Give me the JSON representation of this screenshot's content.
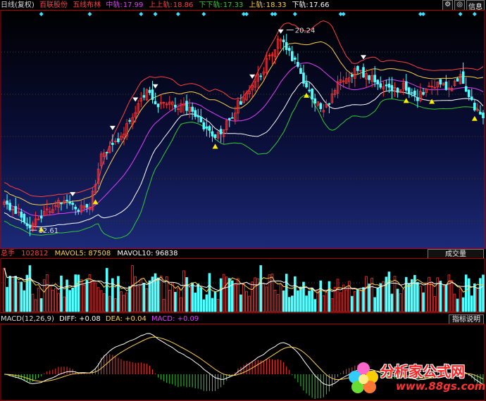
{
  "window": {
    "period_label": "日线(复权)",
    "stock_name": "百联股份",
    "indicator_name": "五线布林",
    "buttons": [
      {
        "label": "⚙"
      },
      {
        "label": "◎"
      },
      {
        "label": "信息"
      }
    ],
    "readouts": [
      {
        "label": "中轨:",
        "value": "17.99",
        "color": "#e040fb"
      },
      {
        "label": "上上轨:",
        "value": "18.86",
        "color": "#ff4040"
      },
      {
        "label": "下下轨:",
        "value": "17.33",
        "color": "#32cd32"
      },
      {
        "label": "上轨:",
        "value": "18.33",
        "color": "#ffd24a"
      },
      {
        "label": "下轨:",
        "value": "17.66",
        "color": "#ffffff"
      }
    ]
  },
  "price_panel": {
    "high_label": "20.24",
    "low_label": "12.61"
  },
  "volume_panel": {
    "title": "总手",
    "value": "102812",
    "mavol5_label": "MAVOL5:",
    "mavol5": "87508",
    "mavol10_label": "MAVOL10:",
    "mavol10": "96838",
    "button_label": "成交量"
  },
  "macd_panel": {
    "title": "MACD(12,26,9)",
    "diff_label": "DIFF:",
    "diff": "+0.08",
    "dea_label": "DEA:",
    "dea": "+0.04",
    "macd_label": "MACD:",
    "macd": "+0.09",
    "button_label": "指标说明"
  },
  "watermark": {
    "title": "分析家公式网",
    "url": "www.88gs.com"
  },
  "colors": {
    "up": "#ff3232",
    "down": "#54ffff",
    "upper2": "#ff4040",
    "upper": "#ffd24a",
    "mid": "#e040fb",
    "lower": "#ffffff",
    "lower2": "#32cd32"
  },
  "chart_data": {
    "type": "line",
    "price_range": [
      12.0,
      20.9
    ],
    "high": 20.24,
    "low": 12.61,
    "close_keypoints": [
      [
        0,
        13.6
      ],
      [
        5,
        13.3
      ],
      [
        9,
        12.8
      ],
      [
        14,
        13.3
      ],
      [
        20,
        13.7
      ],
      [
        25,
        13.4
      ],
      [
        30,
        13.6
      ],
      [
        34,
        15.4
      ],
      [
        38,
        15.9
      ],
      [
        42,
        16.4
      ],
      [
        46,
        17.2
      ],
      [
        50,
        17.9
      ],
      [
        54,
        17.4
      ],
      [
        58,
        17.5
      ],
      [
        62,
        17.3
      ],
      [
        66,
        17.2
      ],
      [
        70,
        16.6
      ],
      [
        74,
        16.1
      ],
      [
        78,
        16.7
      ],
      [
        82,
        17.4
      ],
      [
        86,
        18.0
      ],
      [
        90,
        18.6
      ],
      [
        94,
        19.4
      ],
      [
        97,
        19.9
      ],
      [
        100,
        19.3
      ],
      [
        104,
        18.6
      ],
      [
        108,
        17.6
      ],
      [
        112,
        17.1
      ],
      [
        116,
        18.0
      ],
      [
        120,
        18.5
      ],
      [
        124,
        18.7
      ],
      [
        128,
        18.4
      ],
      [
        132,
        18.2
      ],
      [
        136,
        17.8
      ],
      [
        140,
        18.2
      ],
      [
        144,
        17.6
      ],
      [
        148,
        17.9
      ],
      [
        152,
        18.3
      ],
      [
        156,
        18.0
      ],
      [
        160,
        18.4
      ],
      [
        165,
        17.3
      ],
      [
        168,
        16.9
      ]
    ],
    "sell_signal_bars": [
      24,
      38,
      46,
      53,
      87,
      97,
      126
    ],
    "buy_signal_bars": [
      13,
      32,
      74,
      106,
      141,
      150,
      165
    ],
    "top_markers_bars": [
      13,
      30,
      48,
      53,
      61,
      70,
      84,
      85,
      94,
      95,
      102,
      118,
      119,
      146,
      147,
      160,
      165
    ]
  }
}
